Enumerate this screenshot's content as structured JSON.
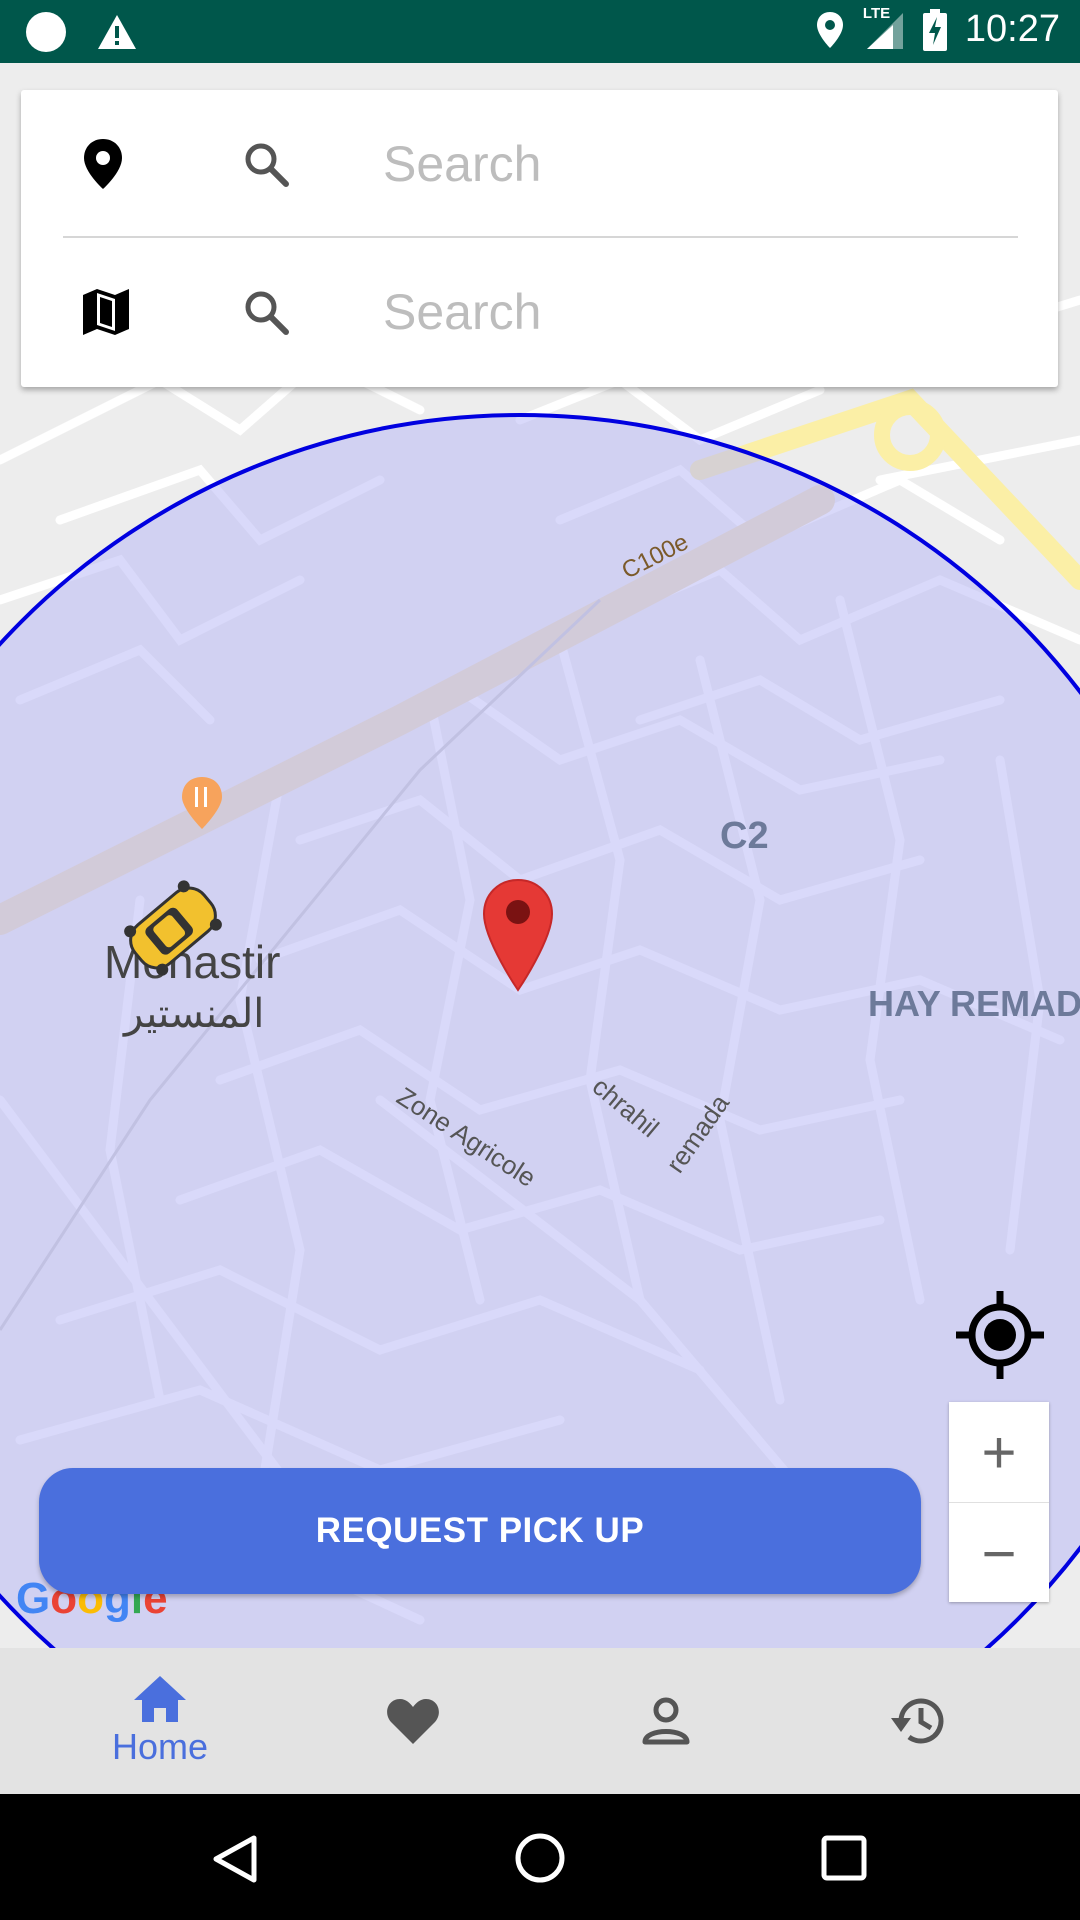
{
  "status_bar": {
    "time": "10:27",
    "network": "LTE",
    "icons": [
      "circle-icon",
      "warning-icon",
      "location-icon",
      "signal-icon",
      "battery-charging-icon"
    ]
  },
  "search": {
    "pickup": {
      "icon": "location-pin-icon",
      "placeholder": "Search",
      "value": ""
    },
    "destination": {
      "icon": "map-icon",
      "placeholder": "Search",
      "value": ""
    }
  },
  "map": {
    "labels": {
      "road": "C100e",
      "district_c2": "C2",
      "hay_remada": "HAY REMAD",
      "city": "Monastir",
      "city_arabic": "المنستير",
      "zone": "Zone Agricole",
      "chrahil": "chrahil",
      "remada": "remada"
    },
    "circle_color": "#0000e0",
    "circle_fill": "#b9b9f5",
    "marker_color": "#e53935",
    "attribution": "Google"
  },
  "request_button": {
    "label": "REQUEST PICK UP",
    "color": "#4a6fdd"
  },
  "zoom": {
    "in": "+",
    "out": "−"
  },
  "bottom_nav": {
    "items": [
      {
        "id": "home",
        "label": "Home",
        "icon": "home-icon",
        "active": true
      },
      {
        "id": "favorites",
        "label": "",
        "icon": "heart-icon",
        "active": false
      },
      {
        "id": "profile",
        "label": "",
        "icon": "person-icon",
        "active": false
      },
      {
        "id": "history",
        "label": "",
        "icon": "history-icon",
        "active": false
      }
    ],
    "active_color": "#4a6fdd",
    "inactive_color": "#555555"
  }
}
